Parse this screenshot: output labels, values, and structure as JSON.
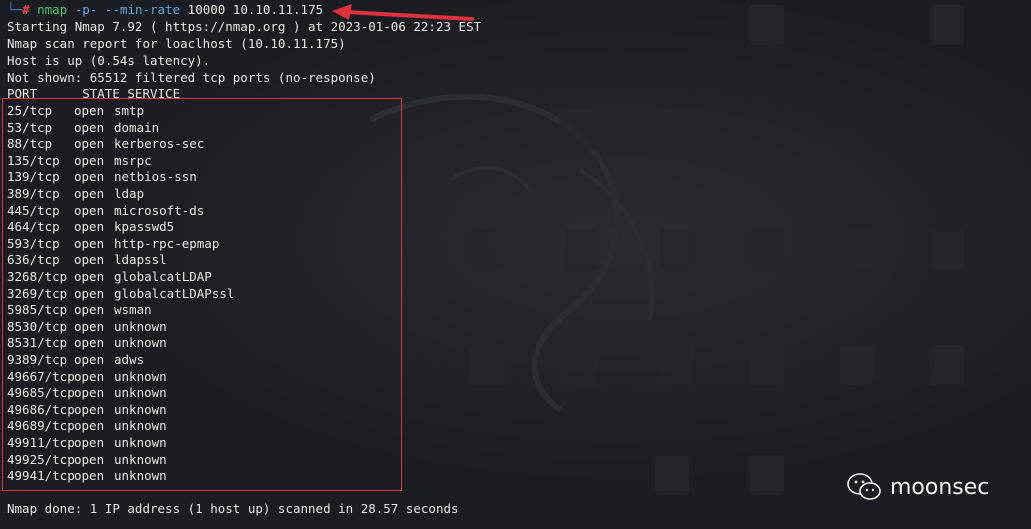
{
  "prompt": {
    "corner": "└─",
    "hash": "#",
    "command_name": "nmap",
    "arg_p": "-p-",
    "arg_rate_flag": "--min-rate",
    "rest": "10000 10.10.11.175"
  },
  "output": {
    "start_line": "Starting Nmap 7.92 ( https://nmap.org ) at 2023-01-06 22:23 EST",
    "report_line": "Nmap scan report for loaclhost (10.10.11.175)",
    "host_line": "Host is up (0.54s latency).",
    "not_shown_line": "Not shown: 65512 filtered tcp ports (no-response)",
    "header": "PORT      STATE SERVICE",
    "done_line": "Nmap done: 1 IP address (1 host up) scanned in 28.57 seconds"
  },
  "ports": [
    {
      "port": "25/tcp",
      "state": "open",
      "service": "smtp"
    },
    {
      "port": "53/tcp",
      "state": "open",
      "service": "domain"
    },
    {
      "port": "88/tcp",
      "state": "open",
      "service": "kerberos-sec"
    },
    {
      "port": "135/tcp",
      "state": "open",
      "service": "msrpc"
    },
    {
      "port": "139/tcp",
      "state": "open",
      "service": "netbios-ssn"
    },
    {
      "port": "389/tcp",
      "state": "open",
      "service": "ldap"
    },
    {
      "port": "445/tcp",
      "state": "open",
      "service": "microsoft-ds"
    },
    {
      "port": "464/tcp",
      "state": "open",
      "service": "kpasswd5"
    },
    {
      "port": "593/tcp",
      "state": "open",
      "service": "http-rpc-epmap"
    },
    {
      "port": "636/tcp",
      "state": "open",
      "service": "ldapssl"
    },
    {
      "port": "3268/tcp",
      "state": "open",
      "service": "globalcatLDAP"
    },
    {
      "port": "3269/tcp",
      "state": "open",
      "service": "globalcatLDAPssl"
    },
    {
      "port": "5985/tcp",
      "state": "open",
      "service": "wsman"
    },
    {
      "port": "8530/tcp",
      "state": "open",
      "service": "unknown"
    },
    {
      "port": "8531/tcp",
      "state": "open",
      "service": "unknown"
    },
    {
      "port": "9389/tcp",
      "state": "open",
      "service": "adws"
    },
    {
      "port": "49667/tcp",
      "state": "open",
      "service": "unknown"
    },
    {
      "port": "49685/tcp",
      "state": "open",
      "service": "unknown"
    },
    {
      "port": "49686/tcp",
      "state": "open",
      "service": "unknown"
    },
    {
      "port": "49689/tcp",
      "state": "open",
      "service": "unknown"
    },
    {
      "port": "49911/tcp",
      "state": "open",
      "service": "unknown"
    },
    {
      "port": "49925/tcp",
      "state": "open",
      "service": "unknown"
    },
    {
      "port": "49941/tcp",
      "state": "open",
      "service": "unknown"
    }
  ],
  "watermark": {
    "text": "moonsec",
    "icon": "wechat-icon"
  },
  "colors": {
    "background": "#1c1d22",
    "text": "#e6e6e6",
    "prompt_hash": "#e04545",
    "command": "#4fbf6a",
    "argument": "#5aa6e8",
    "highlight_box": "#d9343f",
    "arrow": "#e0313c"
  }
}
